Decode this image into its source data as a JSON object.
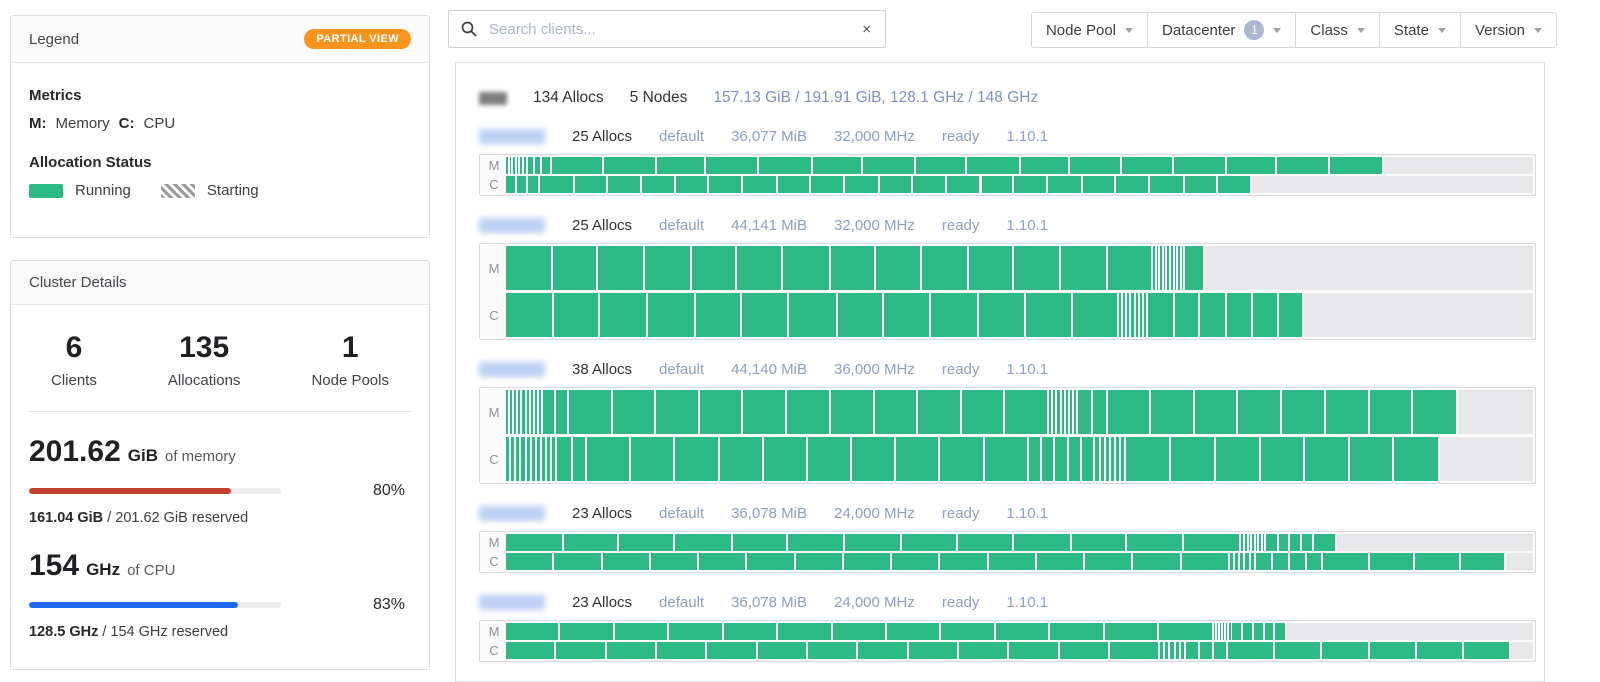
{
  "colors": {
    "running_green": "#2eba84",
    "badge_orange": "#f7941d",
    "memory_red": "#c2402f",
    "cpu_blue": "#1e68f5",
    "meta_blue_gray": "#8ca0c0"
  },
  "legend": {
    "title": "Legend",
    "badge": "PARTIAL VIEW",
    "metrics_title": "Metrics",
    "metrics": [
      {
        "key": "M:",
        "label": "Memory"
      },
      {
        "key": "C:",
        "label": "CPU"
      }
    ],
    "alloc_status_title": "Allocation Status",
    "statuses": [
      {
        "label": "Running"
      },
      {
        "label": "Starting"
      }
    ]
  },
  "cluster": {
    "title": "Cluster Details",
    "stats": [
      {
        "value": "6",
        "label": "Clients"
      },
      {
        "value": "135",
        "label": "Allocations"
      },
      {
        "value": "1",
        "label": "Node Pools"
      }
    ],
    "memory": {
      "value": "201.62",
      "unit": "GiB",
      "suffix": "of memory",
      "percent": "80%",
      "fill_pct": "80%",
      "detail_bold": "161.04 GiB",
      "detail_rest": " / 201.62 GiB reserved"
    },
    "cpu": {
      "value": "154",
      "unit": "GHz",
      "suffix": "of CPU",
      "percent": "83%",
      "fill_pct": "83%",
      "detail_bold": "128.5 GHz",
      "detail_rest": " / 154 GHz reserved"
    }
  },
  "search": {
    "placeholder": "Search clients...",
    "clear": "×"
  },
  "filters": [
    {
      "label": "Node Pool",
      "badge": ""
    },
    {
      "label": "Datacenter",
      "badge": "1"
    },
    {
      "label": "Class",
      "badge": ""
    },
    {
      "label": "State",
      "badge": ""
    },
    {
      "label": "Version",
      "badge": ""
    }
  ],
  "topology": {
    "summary": {
      "allocs": "134 Allocs",
      "nodes": "5 Nodes",
      "stats": "157.13 GiB / 191.91 GiB, 128.1 GHz / 148 GHz"
    },
    "row_labels": {
      "memory": "M",
      "cpu": "C"
    },
    "nodes": [
      {
        "allocs": "25 Allocs",
        "pool": "default",
        "memory": "36,077 MiB",
        "cpu": "32,000 MHz",
        "state": "ready",
        "version": "1.10.1",
        "m_segments": [
          0.35,
          0.35,
          0.35,
          0.35,
          0.35,
          0.35,
          0.7,
          0.7,
          1.0,
          5.0,
          5.2,
          4.8,
          5.1,
          5.3,
          4.9,
          5.1,
          5.0,
          5.2,
          4.8,
          5.1,
          5.0,
          5.2,
          4.9,
          5.1,
          5.3
        ],
        "c_segments": [
          1.1,
          1.0,
          1.2,
          3.4,
          3.2,
          3.3,
          3.4,
          3.2,
          3.3,
          3.4,
          3.2,
          3.3,
          3.4,
          3.2,
          3.3,
          3.4,
          3.2,
          3.3,
          3.4,
          3.2,
          3.3,
          3.4,
          3.2,
          3.3
        ]
      },
      {
        "allocs": "25 Allocs",
        "pool": "default",
        "memory": "44,141 MiB",
        "cpu": "32,000 MHz",
        "state": "ready",
        "version": "1.10.1",
        "m_segments": [
          4.6,
          4.4,
          4.5,
          4.6,
          4.4,
          4.5,
          4.6,
          4.4,
          4.5,
          4.6,
          4.4,
          4.5,
          4.6,
          4.4,
          0.35,
          0.35,
          0.35,
          0.35,
          0.35,
          0.35,
          0.35,
          0.35,
          0.35,
          1.9
        ],
        "c_segments": [
          4.7,
          4.5,
          4.6,
          4.7,
          4.5,
          4.6,
          4.7,
          4.5,
          4.6,
          4.7,
          4.5,
          4.6,
          4.5,
          0.4,
          0.4,
          0.4,
          0.4,
          0.4,
          0.4,
          0.4,
          2.6,
          2.5,
          2.6,
          2.5,
          2.6,
          2.4
        ]
      },
      {
        "allocs": "38 Allocs",
        "pool": "default",
        "memory": "44,140 MiB",
        "cpu": "36,000 MHz",
        "state": "ready",
        "version": "1.10.1",
        "m_segments": [
          0.4,
          0.4,
          0.4,
          0.4,
          0.4,
          0.4,
          0.4,
          0.4,
          0.4,
          1.3,
          1.2,
          4.3,
          4.2,
          4.3,
          4.2,
          4.3,
          4.2,
          4.3,
          4.2,
          4.3,
          4.2,
          4.3,
          0.4,
          0.4,
          0.4,
          0.4,
          0.4,
          0.4,
          0.4,
          1.5,
          1.4,
          4.2,
          4.3,
          4.2,
          4.3,
          4.2,
          4.3,
          4.2,
          4.4
        ],
        "c_segments": [
          0.5,
          0.5,
          0.5,
          0.5,
          0.5,
          0.5,
          0.5,
          0.5,
          0.5,
          0.5,
          1.5,
          1.4,
          4.3,
          4.3,
          4.3,
          4.3,
          4.3,
          4.3,
          4.3,
          4.3,
          4.3,
          4.3,
          1.3,
          1.3,
          1.3,
          1.3,
          1.3,
          0.5,
          0.5,
          0.5,
          0.5,
          0.5,
          0.5,
          4.4,
          4.3,
          4.4,
          4.3,
          4.4,
          4.3,
          4.4
        ]
      },
      {
        "allocs": "23 Allocs",
        "pool": "default",
        "memory": "36,078 MiB",
        "cpu": "24,000 MHz",
        "state": "ready",
        "version": "1.10.1",
        "m_segments": [
          5.6,
          5.4,
          5.5,
          5.6,
          5.4,
          5.5,
          5.6,
          5.4,
          5.5,
          5.6,
          5.4,
          5.5,
          5.6,
          0.35,
          0.35,
          0.35,
          0.35,
          0.35,
          0.35,
          0.35,
          1.2,
          1.1,
          1.2,
          1.1,
          2.3
        ],
        "c_segments": [
          4.7,
          4.7,
          4.7,
          4.7,
          4.7,
          4.7,
          4.7,
          4.7,
          4.7,
          4.7,
          4.7,
          4.7,
          4.7,
          4.7,
          4.7,
          0.5,
          0.5,
          0.5,
          0.5,
          0.5,
          1.7,
          1.6,
          1.7,
          1.6,
          4.5,
          4.4,
          4.5,
          4.4
        ]
      },
      {
        "allocs": "23 Allocs",
        "pool": "default",
        "memory": "36,078 MiB",
        "cpu": "24,000 MHz",
        "state": "ready",
        "version": "1.10.1",
        "m_segments": [
          5.3,
          5.3,
          5.3,
          5.3,
          5.3,
          5.3,
          5.3,
          5.3,
          5.3,
          5.3,
          5.3,
          5.3,
          5.3,
          0.3,
          0.3,
          0.3,
          0.3,
          0.3,
          0.3,
          1.1,
          1.0,
          1.1,
          1.0,
          1.1
        ],
        "c_segments": [
          4.9,
          4.9,
          4.9,
          4.9,
          4.9,
          4.9,
          4.9,
          4.9,
          4.9,
          4.9,
          4.9,
          4.9,
          4.9,
          0.5,
          0.5,
          0.5,
          0.5,
          0.5,
          1.4,
          1.3,
          1.4,
          4.6,
          4.6,
          4.6,
          4.6,
          4.6,
          4.6
        ]
      }
    ]
  }
}
